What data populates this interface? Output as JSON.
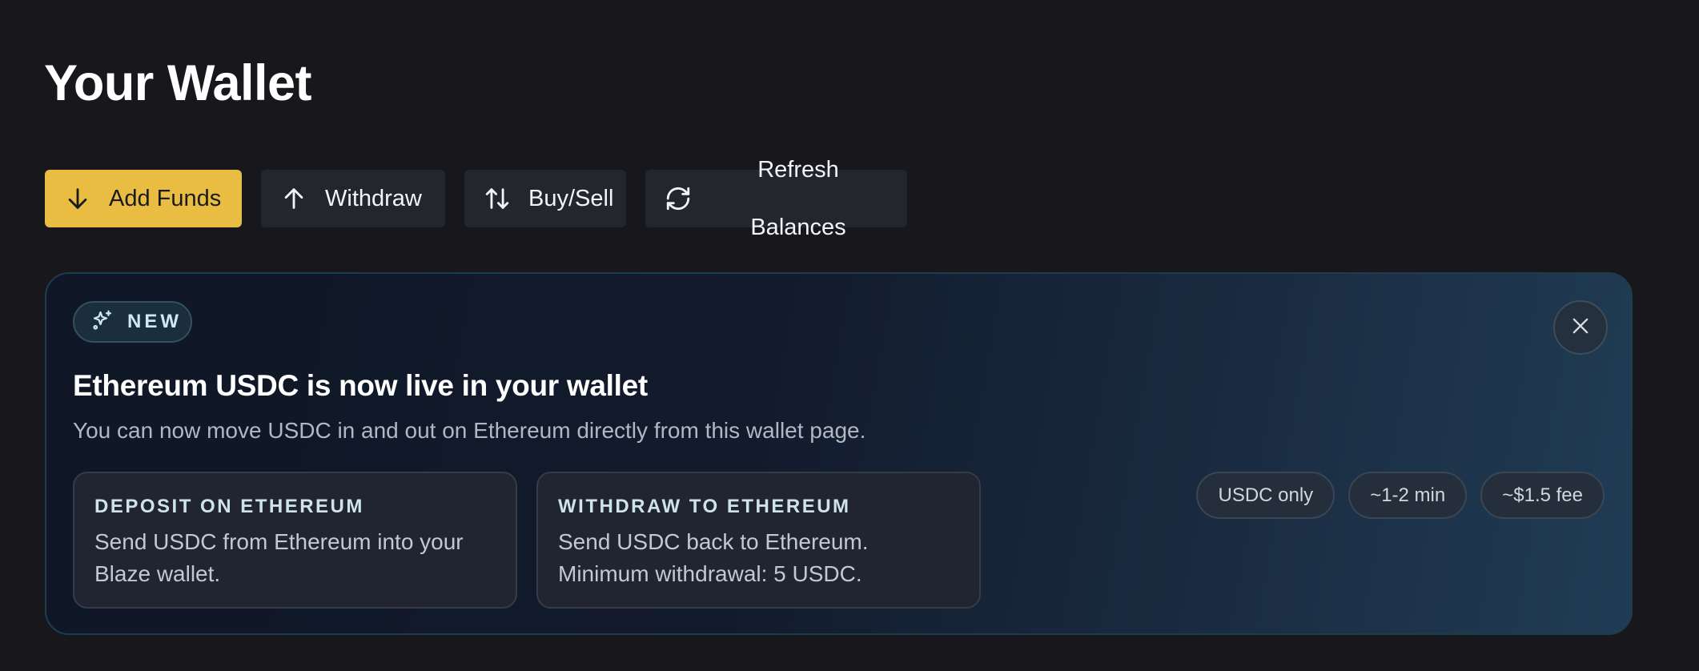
{
  "page": {
    "title": "Your Wallet"
  },
  "toolbar": {
    "add_funds": {
      "label": "Add Funds",
      "icon": "arrow-down-icon"
    },
    "withdraw": {
      "label": "Withdraw",
      "icon": "arrow-up-icon"
    },
    "buy_sell": {
      "label": "Buy/Sell",
      "icon": "arrows-up-down-icon"
    },
    "refresh": {
      "label": "Refresh Balances",
      "icon": "refresh-icon"
    }
  },
  "announcement": {
    "badge": "NEW",
    "badge_icon": "sparkles-icon",
    "title": "Ethereum USDC is now live in your wallet",
    "subtitle": "You can now move USDC in and out on Ethereum directly from this wallet page.",
    "cards": [
      {
        "title": "DEPOSIT ON ETHEREUM",
        "description": "Send USDC from Ethereum into your Blaze wallet."
      },
      {
        "title": "WITHDRAW TO ETHEREUM",
        "description": "Send USDC back to Ethereum. Minimum withdrawal: 5 USDC."
      }
    ],
    "chips": [
      "USDC only",
      "~1-2 min",
      "~$1.5 fee"
    ],
    "close_icon": "close-icon"
  },
  "colors": {
    "background": "#18181c",
    "primary": "#e9bd42",
    "secondary_button": "#24262d",
    "banner_border": "#1f3c4e"
  }
}
